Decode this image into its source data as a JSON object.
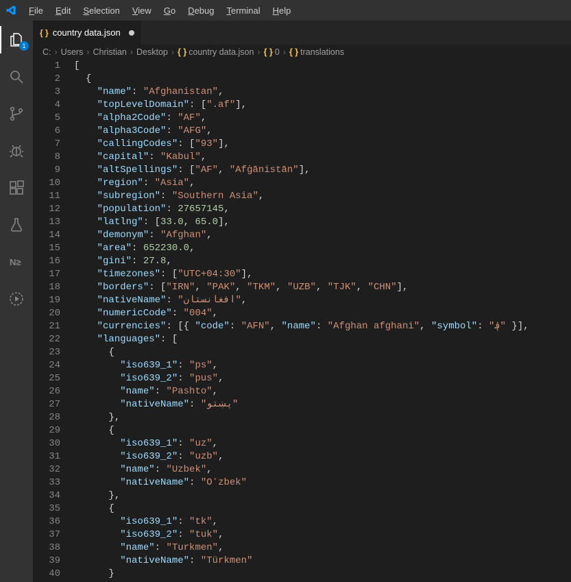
{
  "menu": [
    "File",
    "Edit",
    "Selection",
    "View",
    "Go",
    "Debug",
    "Terminal",
    "Help"
  ],
  "tab": {
    "label": "country data.json",
    "dirty": true
  },
  "explorerBadge": "1",
  "breadcrumb": [
    "C:",
    "Users",
    "Christian",
    "Desktop",
    "country data.json",
    "0",
    "translations"
  ],
  "code": {
    "lineStart": 1,
    "lineEnd": 40,
    "country": {
      "name": "Afghanistan",
      "topLevelDomain": [
        ".af"
      ],
      "alpha2Code": "AF",
      "alpha3Code": "AFG",
      "callingCodes": [
        "93"
      ],
      "capital": "Kabul",
      "altSpellings": [
        "AF",
        "Afġānistān"
      ],
      "region": "Asia",
      "subregion": "Southern Asia",
      "population": 27657145,
      "latlng": [
        33.0,
        65.0
      ],
      "demonym": "Afghan",
      "area": 652230.0,
      "gini": 27.8,
      "timezones": [
        "UTC+04:30"
      ],
      "borders": [
        "IRN",
        "PAK",
        "TKM",
        "UZB",
        "TJK",
        "CHN"
      ],
      "nativeName": "افغانستان",
      "numericCode": "004",
      "currencies": [
        {
          "code": "AFN",
          "name": "Afghan afghani",
          "symbol": "؋"
        }
      ],
      "languages": [
        {
          "iso639_1": "ps",
          "iso639_2": "pus",
          "name": "Pashto",
          "nativeName": "پښتو"
        },
        {
          "iso639_1": "uz",
          "iso639_2": "uzb",
          "name": "Uzbek",
          "nativeName": "Oʻzbek"
        },
        {
          "iso639_1": "tk",
          "iso639_2": "tuk",
          "name": "Turkmen",
          "nativeName": "Türkmen"
        }
      ]
    }
  }
}
